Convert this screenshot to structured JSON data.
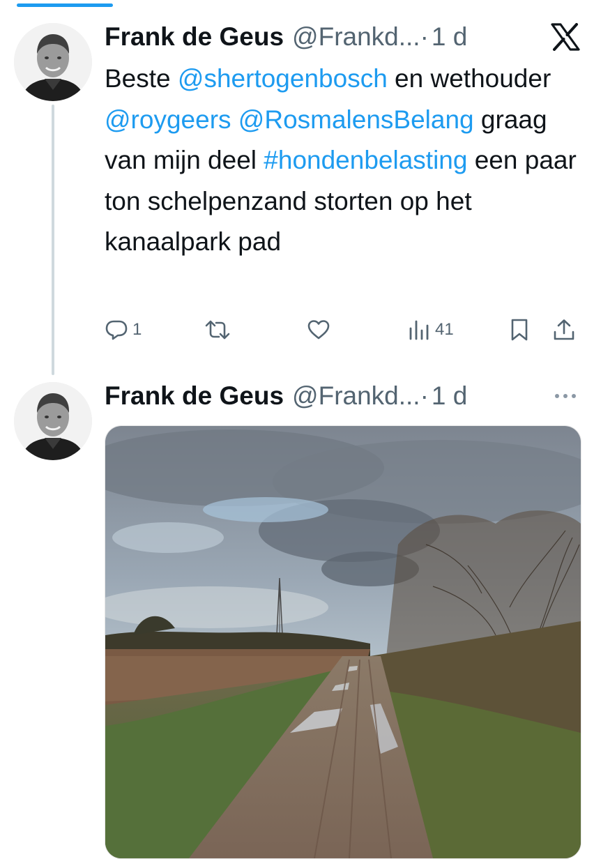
{
  "tweets": [
    {
      "author": {
        "name": "Frank de Geus",
        "handle": "@Frankd...",
        "separator": "·",
        "time": "1 d"
      },
      "text": {
        "t1": "Beste ",
        "m1": "@shertogenbosch",
        "t2": " en wethouder ",
        "m2": "@roygeers",
        "t3": " ",
        "m3": "@RosmalensBelang",
        "t4": " graag van mijn deel ",
        "h1": "#hondenbelasting",
        "t5": " een paar ton schelpenzand storten op het kanaalpark pad"
      },
      "actions": {
        "replies": "1",
        "reposts": "",
        "likes": "",
        "views": "41"
      }
    },
    {
      "author": {
        "name": "Frank de Geus",
        "handle": "@Frankd...",
        "separator": "·",
        "time": "1 d"
      }
    }
  ],
  "icons": {
    "top_right": "x-logo-icon",
    "second_tweet_menu": "more-dots-icon",
    "reply": "reply-icon",
    "repost": "repost-icon",
    "like": "heart-icon",
    "views": "views-icon",
    "bookmark": "bookmark-icon",
    "share": "share-icon"
  },
  "colors": {
    "link": "#1d9bf0",
    "muted": "#536471",
    "text": "#0f1419",
    "thread_line": "#cfd9de"
  }
}
